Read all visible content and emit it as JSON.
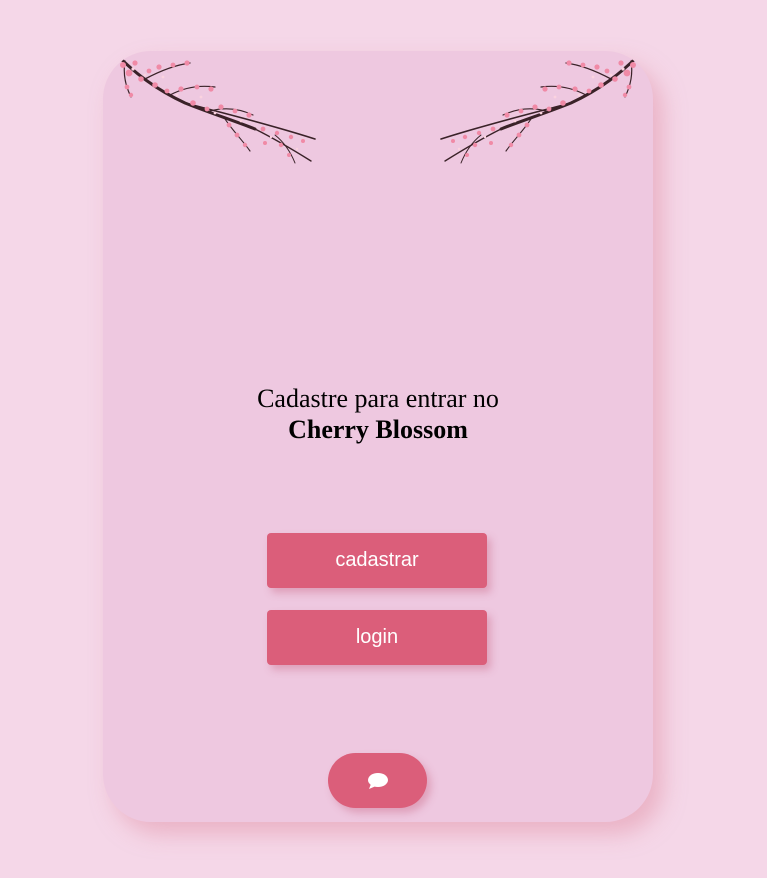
{
  "page": {
    "background_color": "#f5d7e8",
    "card_color": "#eec8e0",
    "accent_color": "#db5e7a"
  },
  "header": {
    "decoration_left": "cherry-blossom-branch",
    "decoration_right": "cherry-blossom-branch"
  },
  "heading": {
    "line1": "Cadastre para entrar no",
    "line2": "Cherry Blossom"
  },
  "actions": {
    "register_label": "cadastrar",
    "login_label": "login"
  },
  "footer": {
    "chat_icon": "chat-bubble-icon"
  }
}
